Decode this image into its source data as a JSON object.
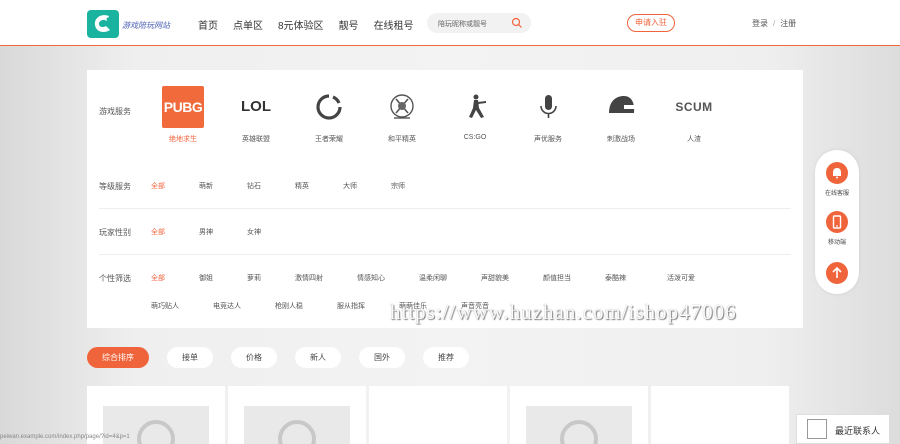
{
  "header": {
    "logo_text": "游戏陪玩网站",
    "nav": [
      "首页",
      "点单区",
      "8元体验区",
      "靓号",
      "在线租号"
    ],
    "search_placeholder": "陪玩昵称或靓号",
    "apply_label": "申请入驻",
    "login_label": "登录",
    "auth_sep": "/",
    "register_label": "注册"
  },
  "filters": {
    "game_label": "游戏服务",
    "games": [
      {
        "name": "绝地求生",
        "icon": "pubg-icon",
        "logo_text": "PUBG",
        "active": true
      },
      {
        "name": "英雄联盟",
        "icon": "lol-icon",
        "logo_text": "LOL"
      },
      {
        "name": "王者荣耀",
        "icon": "honor-of-kings-icon"
      },
      {
        "name": "和平精英",
        "icon": "peace-elite-icon"
      },
      {
        "name": "CS:GO",
        "icon": "csgo-icon"
      },
      {
        "name": "声优服务",
        "icon": "microphone-icon"
      },
      {
        "name": "刺激战场",
        "icon": "helmet-icon"
      },
      {
        "name": "人渣",
        "icon": "scum-icon",
        "logo_text": "SCUM"
      }
    ],
    "level_label": "等级服务",
    "levels": [
      "全部",
      "萌新",
      "钻石",
      "精英",
      "大师",
      "宗师"
    ],
    "gender_label": "玩家性别",
    "genders": [
      "全部",
      "男神",
      "女神"
    ],
    "personality_label": "个性筛选",
    "personality_row1": [
      "全部",
      "御姐",
      "萝莉",
      "激情四射",
      "情感知心",
      "温柔闲聊",
      "声甜貌美",
      "颜值担当",
      "泰酷辣",
      "活泼可爱"
    ],
    "personality_row2": [
      "萌巧贴人",
      "电竞达人",
      "枪刚人稳",
      "服从指挥",
      "萌萌佳乐",
      "声音亮音"
    ]
  },
  "sort": [
    "综合排序",
    "接单",
    "价格",
    "新人",
    "国外",
    "推荐"
  ],
  "float_bar": {
    "service_label": "在线客服",
    "mobile_label": "移动端"
  },
  "watermark": "https://www.huzhan.com/ishop47006",
  "contact_label": "最近联系人",
  "status_url": "peiwan.example.com/index.php/page/?id=4&p=1",
  "colors": {
    "accent": "#f0643c",
    "logo_teal": "#19b3a0"
  }
}
